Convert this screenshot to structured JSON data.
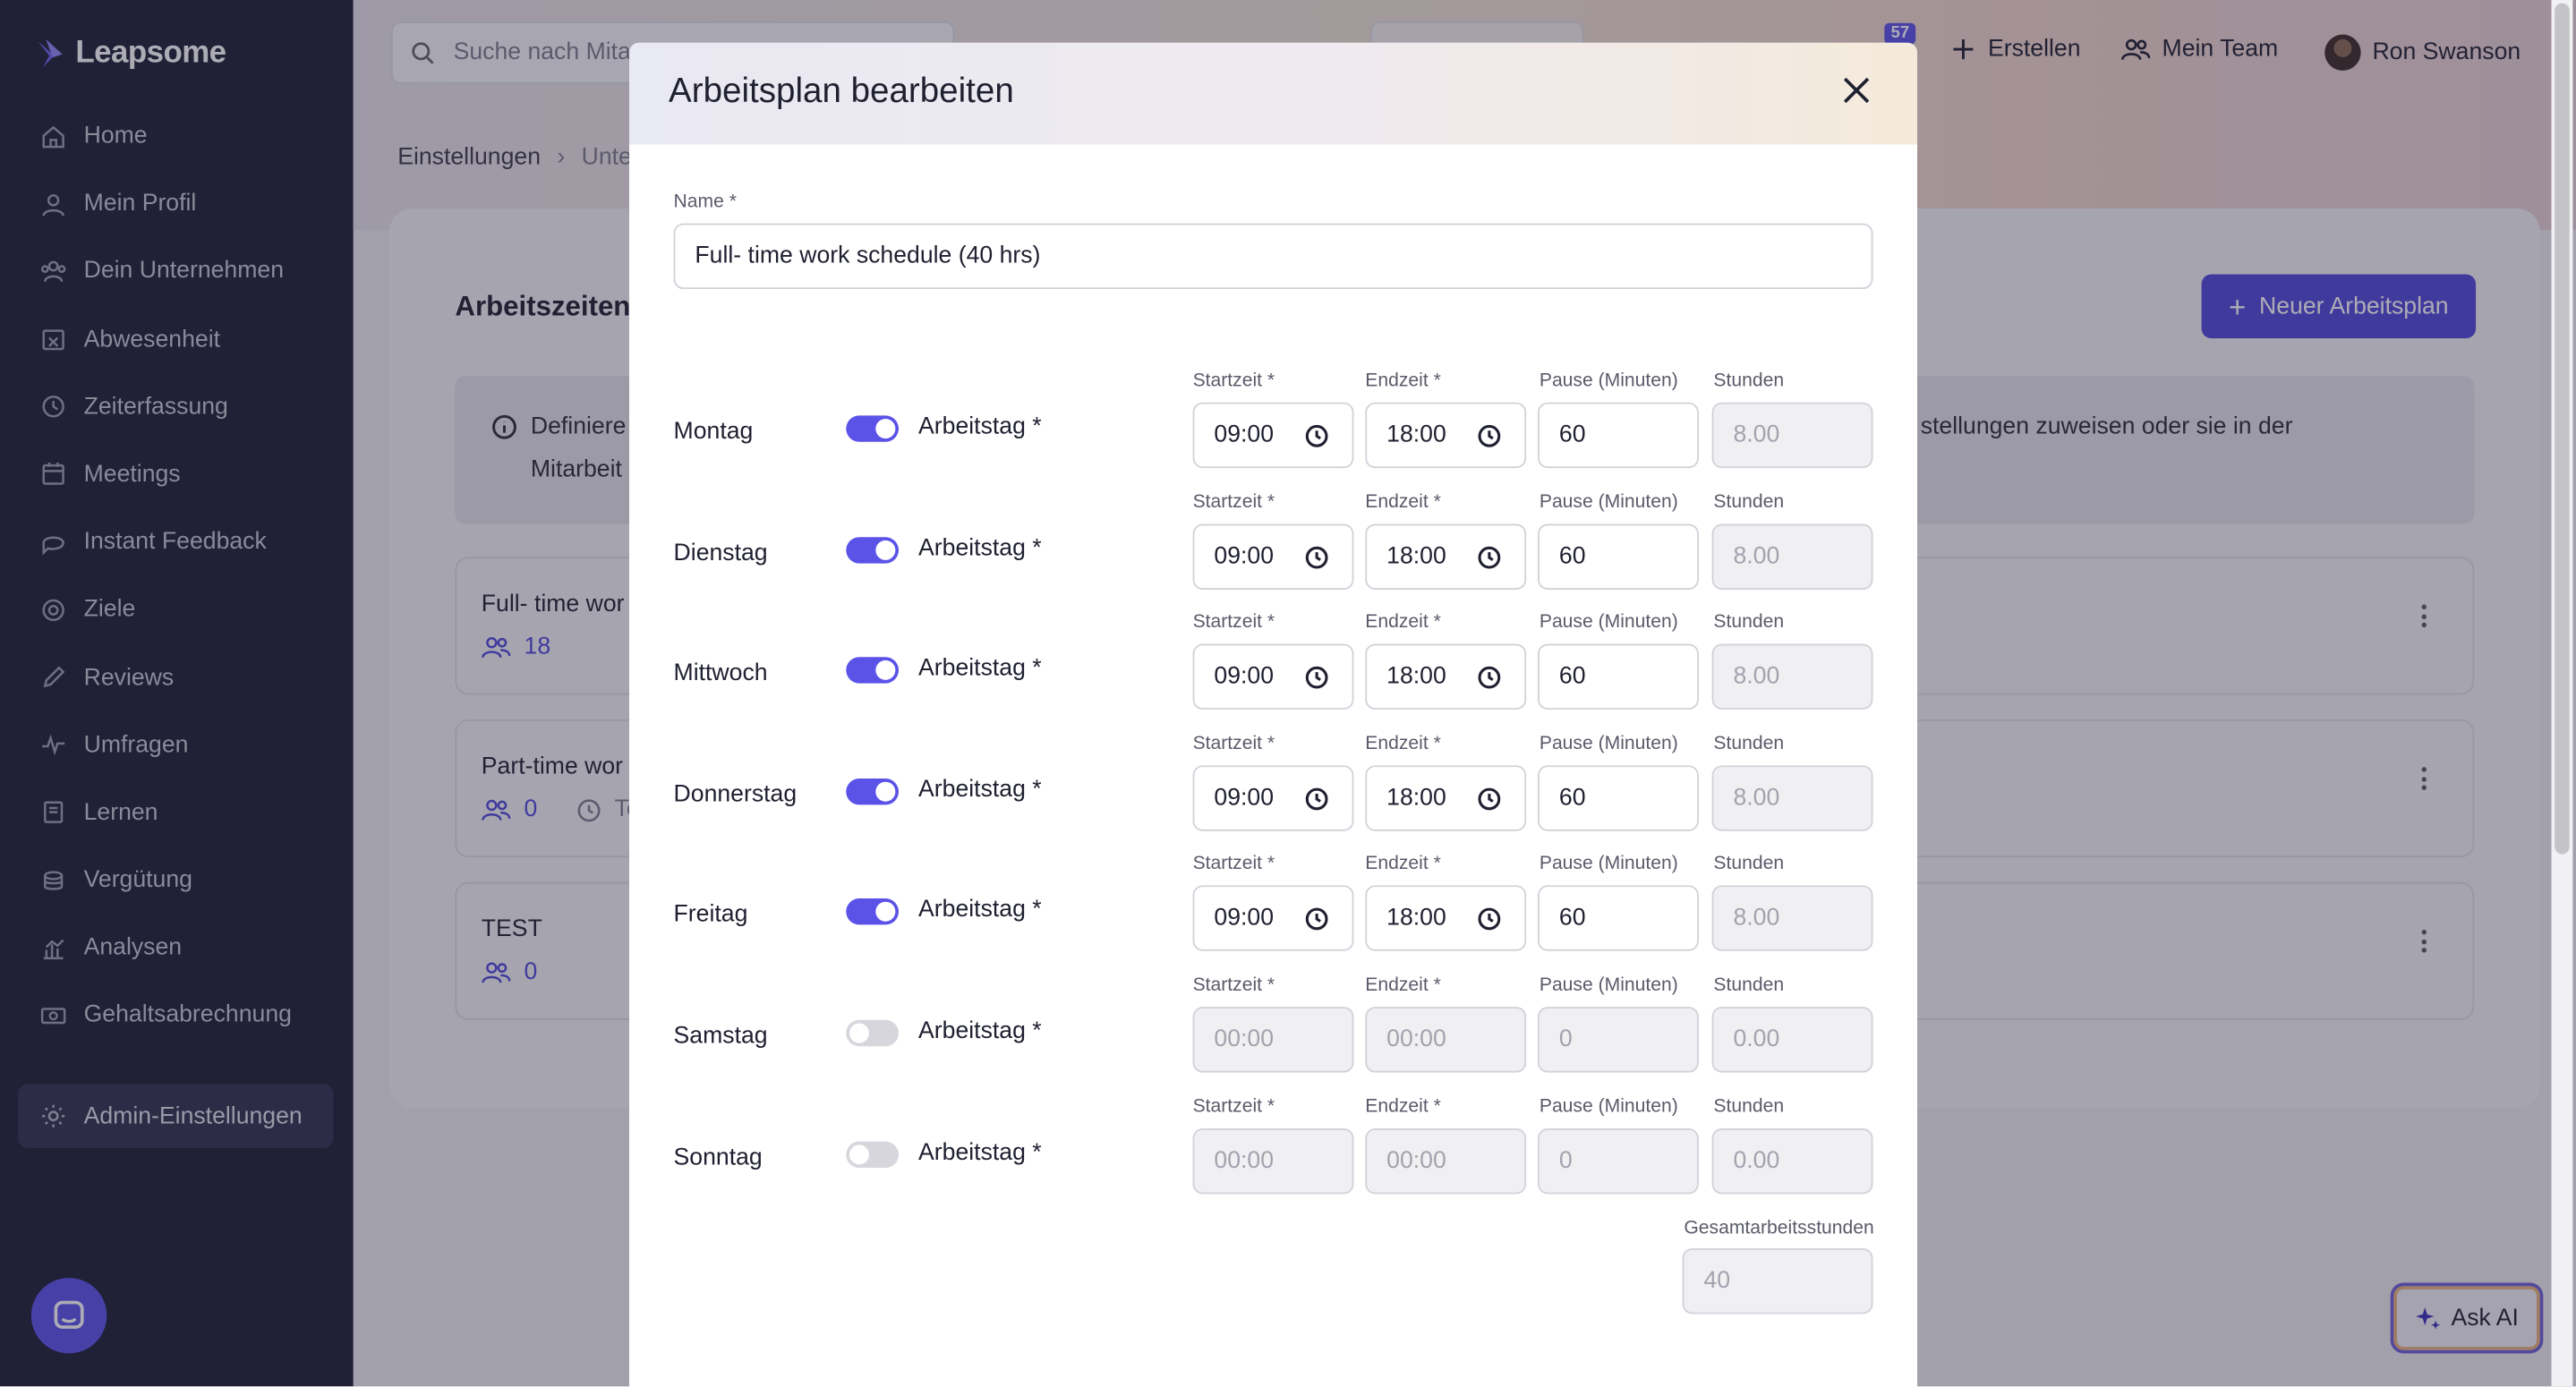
{
  "app": {
    "brand": "Leapsome"
  },
  "sidebar": {
    "items": [
      {
        "label": "Home",
        "icon": "home-icon"
      },
      {
        "label": "Mein Profil",
        "icon": "user-icon"
      },
      {
        "label": "Dein Unternehmen",
        "icon": "company-icon"
      },
      {
        "label": "Abwesenheit",
        "icon": "calendar-x-icon"
      },
      {
        "label": "Zeiterfassung",
        "icon": "clock-icon"
      },
      {
        "label": "Meetings",
        "icon": "calendar-icon"
      },
      {
        "label": "Instant Feedback",
        "icon": "chat-icon"
      },
      {
        "label": "Ziele",
        "icon": "target-icon"
      },
      {
        "label": "Reviews",
        "icon": "pencil-icon"
      },
      {
        "label": "Umfragen",
        "icon": "pulse-icon"
      },
      {
        "label": "Lernen",
        "icon": "book-icon"
      },
      {
        "label": "Vergütung",
        "icon": "coins-icon"
      },
      {
        "label": "Analysen",
        "icon": "chart-icon"
      },
      {
        "label": "Gehaltsabrechnung",
        "icon": "money-icon"
      }
    ],
    "admin_label": "Admin-Einstellungen"
  },
  "topbar": {
    "search_placeholder": "Suche nach Mita",
    "notification_count": "57",
    "create_label": "Erstellen",
    "team_label": "Mein Team",
    "user_name": "Ron Swanson"
  },
  "breadcrumb": {
    "first": "Einstellungen",
    "second": "Unte"
  },
  "page": {
    "title": "Arbeitszeiten",
    "new_plan_label": "Neuer Arbeitsplan",
    "info_line1": "Definiere",
    "info_line2": "Mitarbeit",
    "info_right": "stellungen zuweisen oder sie in der",
    "plans": [
      {
        "name": "Full- time wor",
        "count": "18",
        "extra": ""
      },
      {
        "name": "Part-time wor",
        "count": "0",
        "extra": "Te"
      },
      {
        "name": "TEST",
        "count": "0",
        "extra": ""
      }
    ],
    "ask_ai_label": "Ask AI"
  },
  "modal": {
    "title": "Arbeitsplan bearbeiten",
    "name_label": "Name *",
    "name_value": "Full- time work schedule (40 hrs)",
    "workday_label": "Arbeitstag *",
    "col_start": "Startzeit *",
    "col_end": "Endzeit *",
    "col_pause": "Pause (Minuten)",
    "col_hours": "Stunden",
    "days": [
      {
        "name": "Montag",
        "enabled": true,
        "start": "09:00",
        "end": "18:00",
        "pause": "60",
        "hours": "8.00"
      },
      {
        "name": "Dienstag",
        "enabled": true,
        "start": "09:00",
        "end": "18:00",
        "pause": "60",
        "hours": "8.00"
      },
      {
        "name": "Mittwoch",
        "enabled": true,
        "start": "09:00",
        "end": "18:00",
        "pause": "60",
        "hours": "8.00"
      },
      {
        "name": "Donnerstag",
        "enabled": true,
        "start": "09:00",
        "end": "18:00",
        "pause": "60",
        "hours": "8.00"
      },
      {
        "name": "Freitag",
        "enabled": true,
        "start": "09:00",
        "end": "18:00",
        "pause": "60",
        "hours": "8.00"
      },
      {
        "name": "Samstag",
        "enabled": false,
        "start": "00:00",
        "end": "00:00",
        "pause": "0",
        "hours": "0.00"
      },
      {
        "name": "Sonntag",
        "enabled": false,
        "start": "00:00",
        "end": "00:00",
        "pause": "0",
        "hours": "0.00"
      }
    ],
    "total_label": "Gesamtarbeitsstunden",
    "total_value": "40"
  },
  "colors": {
    "accent": "#5b53e8",
    "sidebar_bg": "#1c1d33",
    "button_primary": "#4f47d8"
  }
}
